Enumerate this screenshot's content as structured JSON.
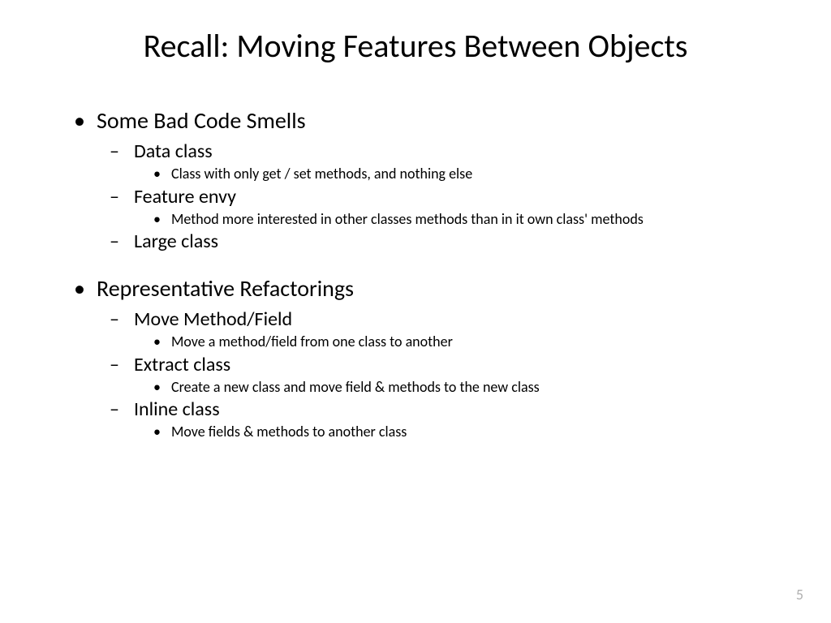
{
  "title": "Recall: Moving Features Between Objects",
  "sections": {
    "a": {
      "heading": "Some Bad Code Smells",
      "items": {
        "0": {
          "label": "Data class",
          "desc": "Class with only get / set methods, and nothing else"
        },
        "1": {
          "label": "Feature envy",
          "desc": "Method more interested in other classes methods than in it own class' methods"
        },
        "2": {
          "label": "Large class"
        }
      }
    },
    "b": {
      "heading": "Representative Refactorings",
      "items": {
        "0": {
          "label": "Move Method/Field",
          "desc": "Move a method/field from one class to another"
        },
        "1": {
          "label": "Extract class",
          "desc": "Create a new class and move field & methods to the new class"
        },
        "2": {
          "label": "Inline class",
          "desc": "Move fields & methods to another class"
        }
      }
    }
  },
  "page_number": "5"
}
